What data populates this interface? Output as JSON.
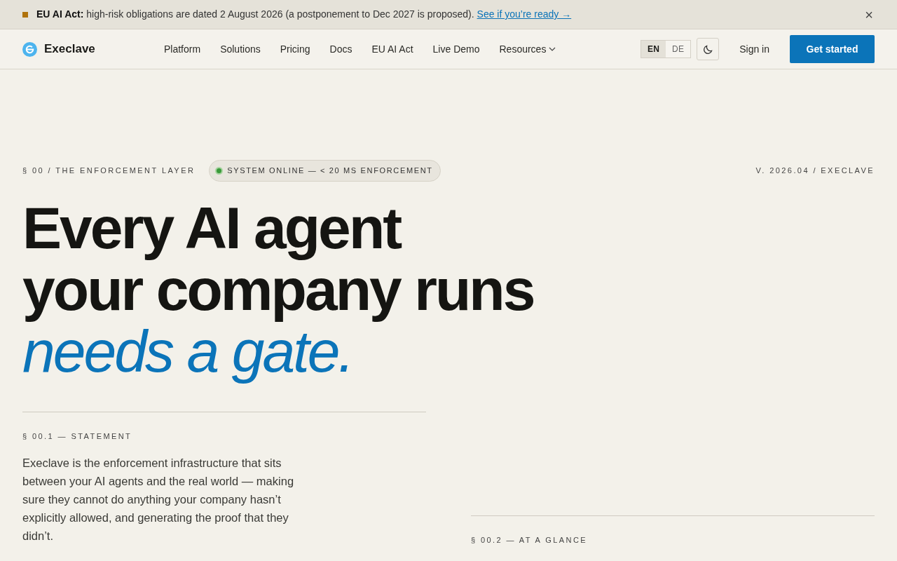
{
  "announcement": {
    "label": "EU AI Act:",
    "text": "high-risk obligations are dated 2 August 2026 (a postponement to Dec 2027 is proposed).",
    "link": "See if you’re ready →",
    "close": "×"
  },
  "nav": {
    "brand": "Execlave",
    "links": [
      {
        "label": "Platform",
        "dropdown": false
      },
      {
        "label": "Solutions",
        "dropdown": false
      },
      {
        "label": "Pricing",
        "dropdown": false
      },
      {
        "label": "Docs",
        "dropdown": false
      },
      {
        "label": "EU AI Act",
        "dropdown": false
      },
      {
        "label": "Live Demo",
        "dropdown": false
      },
      {
        "label": "Resources",
        "dropdown": true
      }
    ],
    "languages": [
      {
        "label": "EN",
        "selected": true
      },
      {
        "label": "DE",
        "selected": false
      }
    ],
    "sign_in": "Sign in",
    "cta": "Get started"
  },
  "hero": {
    "section_label": "§ 00 / THE ENFORCEMENT LAYER",
    "status": {
      "text": "SYSTEM ONLINE — < 20 MS ENFORCEMENT",
      "color": "#3a9a3a"
    },
    "version": "V. 2026.04 / EXECLAVE",
    "headline": [
      "Every AI agent",
      "your company runs"
    ],
    "accent": "needs a gate.",
    "statement_label": "§ 00.1 — STATEMENT",
    "statement": "Execlave is the enforcement infrastructure that sits between your AI agents and the real world — making sure they cannot do anything your company hasn’t explicitly allowed, and generating the proof that they didn’t.",
    "glance_label": "§ 00.2 — AT A GLANCE"
  }
}
